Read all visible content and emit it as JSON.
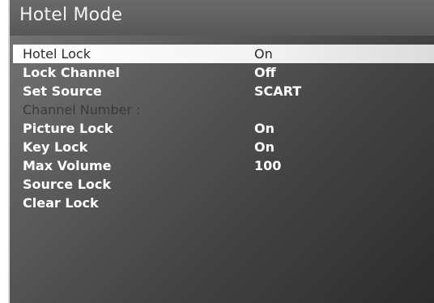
{
  "header": {
    "title": "Hotel Mode"
  },
  "menu": {
    "items": [
      {
        "label": "Hotel Lock",
        "value": "On"
      },
      {
        "label": "Lock Channel",
        "value": "Off"
      },
      {
        "label": "Set Source",
        "value": "SCART"
      },
      {
        "label": "Channel Number :",
        "value": ""
      },
      {
        "label": "Picture Lock",
        "value": "On"
      },
      {
        "label": "Key Lock",
        "value": "On"
      },
      {
        "label": "Max Volume",
        "value": "100"
      },
      {
        "label": "Source Lock",
        "value": ""
      },
      {
        "label": "Clear Lock",
        "value": ""
      }
    ],
    "selected_item": "Hotel Lock",
    "disabled_item": "Channel Number :"
  },
  "colors": {
    "background_dark": "#2c2c2c",
    "background_light": "#777777",
    "highlight": "#ffffff",
    "text": "#ffffff",
    "text_disabled": "#3a3a3a"
  }
}
